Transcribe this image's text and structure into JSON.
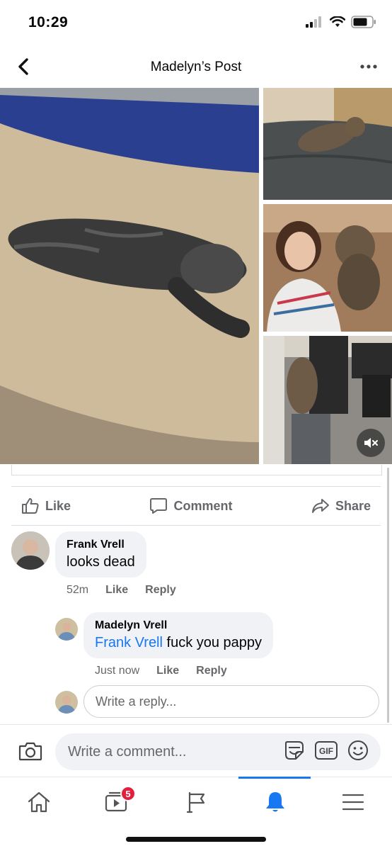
{
  "status": {
    "time": "10:29"
  },
  "nav": {
    "title": "Madelyn’s Post"
  },
  "actions": {
    "like": "Like",
    "comment": "Comment",
    "share": "Share"
  },
  "comments": [
    {
      "name": "Frank Vrell",
      "text": "looks dead",
      "time": "52m",
      "like": "Like",
      "reply": "Reply"
    }
  ],
  "reply": {
    "name": "Madelyn Vrell",
    "mention": "Frank Vrell",
    "text": "fuck you pappy",
    "time": "Just now",
    "like": "Like",
    "reply": "Reply"
  },
  "reply_input": {
    "placeholder": "Write a reply..."
  },
  "composer": {
    "placeholder": "Write a comment...",
    "gif": "GIF"
  },
  "tabbar": {
    "video_badge": "5"
  },
  "colors": {
    "accent": "#1877f2",
    "badge": "#e41e3f",
    "muted": "#65676b",
    "bubble": "#f0f2f5"
  }
}
